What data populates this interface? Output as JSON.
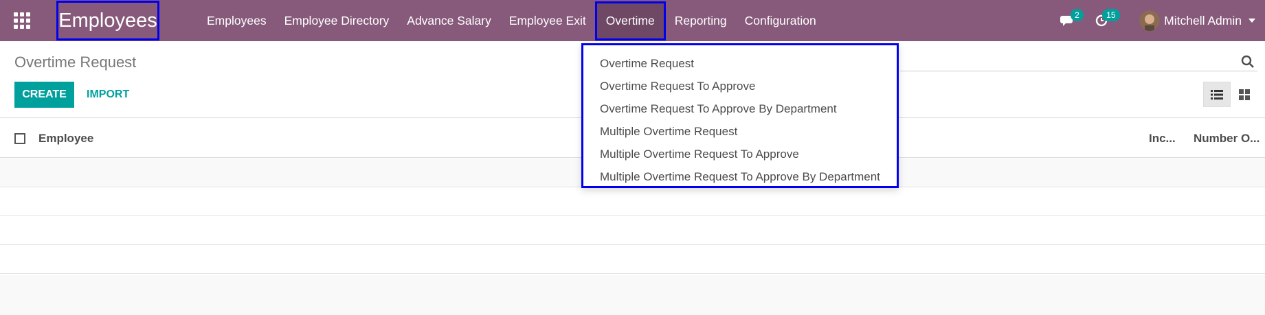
{
  "navbar": {
    "brand": "Employees",
    "menu": [
      {
        "label": "Employees"
      },
      {
        "label": "Employee Directory"
      },
      {
        "label": "Advance Salary"
      },
      {
        "label": "Employee Exit"
      },
      {
        "label": "Overtime"
      },
      {
        "label": "Reporting"
      },
      {
        "label": "Configuration"
      }
    ],
    "messages_count": "2",
    "activities_count": "15",
    "user_name": "Mitchell Admin"
  },
  "control_panel": {
    "breadcrumb": "Overtime Request",
    "create_label": "CREATE",
    "import_label": "IMPORT"
  },
  "table": {
    "columns": [
      "Employee",
      "Inc...",
      "Number O..."
    ]
  },
  "dropdown": {
    "items": [
      "Overtime Request",
      "Overtime Request To Approve",
      "Overtime Request To Approve By Department",
      "Multiple Overtime Request",
      "Multiple Overtime Request To Approve",
      "Multiple Overtime Request To Approve By Department"
    ]
  },
  "colors": {
    "navbar": "#875a7b",
    "accent": "#00a09d",
    "highlight_border": "#0000ee"
  }
}
